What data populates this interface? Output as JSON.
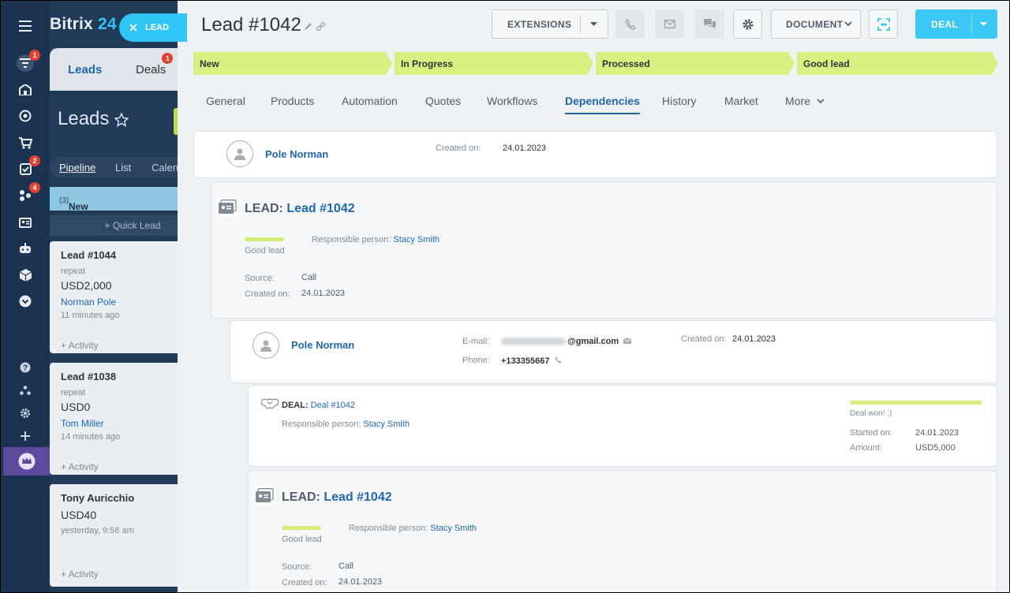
{
  "close_chip": {
    "label": "LEAD"
  },
  "background_app": {
    "logo_text": "Bitrix",
    "logo_number": "24",
    "tabs": [
      {
        "label": "Leads",
        "badge": ""
      },
      {
        "label": "Deals",
        "badge": "1"
      }
    ],
    "title": "Leads",
    "views": [
      "Pipeline",
      "List",
      "Calen"
    ],
    "column": {
      "name": "New",
      "count": "(3)"
    },
    "quick_lead": "Quick Lead",
    "cards": [
      {
        "title": "Lead #1044",
        "subtitle": "repeat",
        "amount": "USD2,000",
        "contact": "Norman Pole",
        "time": "11 minutes ago",
        "activity": "+ Activity"
      },
      {
        "title": "Lead #1038",
        "subtitle": "repeat",
        "amount": "USD0",
        "contact": "Tom Miller",
        "time": "14 minutes ago",
        "activity": "+ Activity"
      },
      {
        "title": "Tony Auricchio",
        "subtitle": "",
        "amount": "USD40",
        "contact": "",
        "time": "yesterday, 9:58 am",
        "activity": "+ Activity"
      }
    ]
  },
  "rail": {
    "badges": {
      "filter": "1",
      "tasks": "2",
      "sites": "4"
    }
  },
  "slider": {
    "title": "Lead #1042",
    "toolbar": {
      "extensions": "EXTENSIONS",
      "document": "DOCUMENT",
      "deal": "DEAL"
    },
    "stages": [
      "New",
      "In Progress",
      "Processed",
      "Good lead"
    ],
    "tabs": [
      "General",
      "Products",
      "Automation",
      "Quotes",
      "Workflows",
      "Dependencies",
      "History",
      "Market",
      "More"
    ],
    "active_tab": "Dependencies",
    "contact_top": {
      "name": "Pole Norman",
      "created_label": "Created on:",
      "created_value": "24.01.2023"
    },
    "lead_section": {
      "prefix": "LEAD:",
      "link": "Lead #1042",
      "stage": "Good lead",
      "responsible_label": "Responsible person:",
      "responsible_value": "Stacy Smith",
      "source_label": "Source:",
      "source_value": "Call",
      "created_label": "Created on:",
      "created_value": "24.01.2023"
    },
    "contact_detail": {
      "name": "Pole Norman",
      "email_label": "E-mail:",
      "email_value": "@gmail.com",
      "phone_label": "Phone:",
      "phone_value": "+133355667",
      "created_label": "Created on:",
      "created_value": "24.01.2023"
    },
    "deal_section": {
      "prefix": "DEAL:",
      "link": "Deal #1042",
      "responsible_label": "Responsible person:",
      "responsible_value": "Stacy Smith",
      "stage": "Deal won! :)",
      "started_label": "Started on:",
      "started_value": "24.01.2023",
      "amount_label": "Amount:",
      "amount_value": "USD5,000"
    },
    "lead_section_2": {
      "prefix": "LEAD:",
      "link": "Lead #1042",
      "stage": "Good lead",
      "responsible_label": "Responsible person:",
      "responsible_value": "Stacy Smith",
      "source_label": "Source:",
      "source_value": "Call",
      "created_label": "Created on:",
      "created_value": "24.01.2023"
    }
  }
}
